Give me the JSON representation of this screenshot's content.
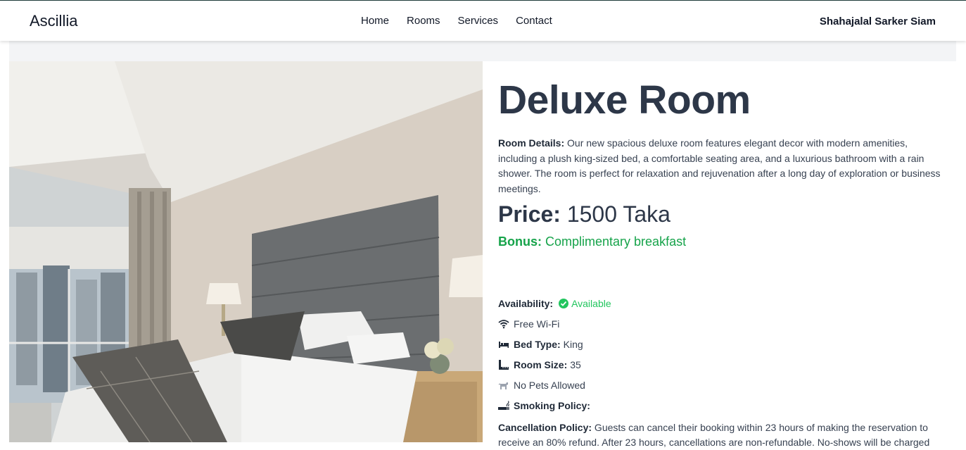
{
  "nav": {
    "brand": "Ascillia",
    "links": [
      "Home",
      "Rooms",
      "Services",
      "Contact"
    ],
    "user": "Shahajalal Sarker Siam"
  },
  "room": {
    "title": "Deluxe Room",
    "details_label": "Room Details:",
    "details_text": " Our new spacious deluxe room features elegant decor with modern amenities, including a plush king-sized bed, a comfortable seating area, and a luxurious bathroom with a rain shower. The room is perfect for relaxation and rejuvenation after a long day of exploration or business meetings.",
    "price_label": "Price:",
    "price_value": " 1500 Taka",
    "bonus_label": "Bonus:",
    "bonus_value": " Complimentary breakfast",
    "availability_label": "Availability:",
    "availability_value": "Available",
    "wifi": "Free Wi-Fi",
    "bed_type_label": "Bed Type:",
    "bed_type_value": "King",
    "room_size_label": "Room Size:",
    "room_size_value": "35",
    "pets": "No Pets Allowed",
    "smoking_label": "Smoking Policy:",
    "smoking_value": "",
    "cancellation_label": "Cancellation Policy:",
    "cancellation_text": " Guests can cancel their booking within 23 hours of making the reservation to receive an 80% refund. After 23 hours, cancellations are non-refundable. No-shows will be charged"
  },
  "colors": {
    "title": "#2d3748",
    "bonus": "#16a34a",
    "available": "#22c55e"
  },
  "icons": [
    "check-circle-icon",
    "wifi-icon",
    "bed-icon",
    "ruler-icon",
    "no-pets-icon",
    "smoking-icon"
  ]
}
